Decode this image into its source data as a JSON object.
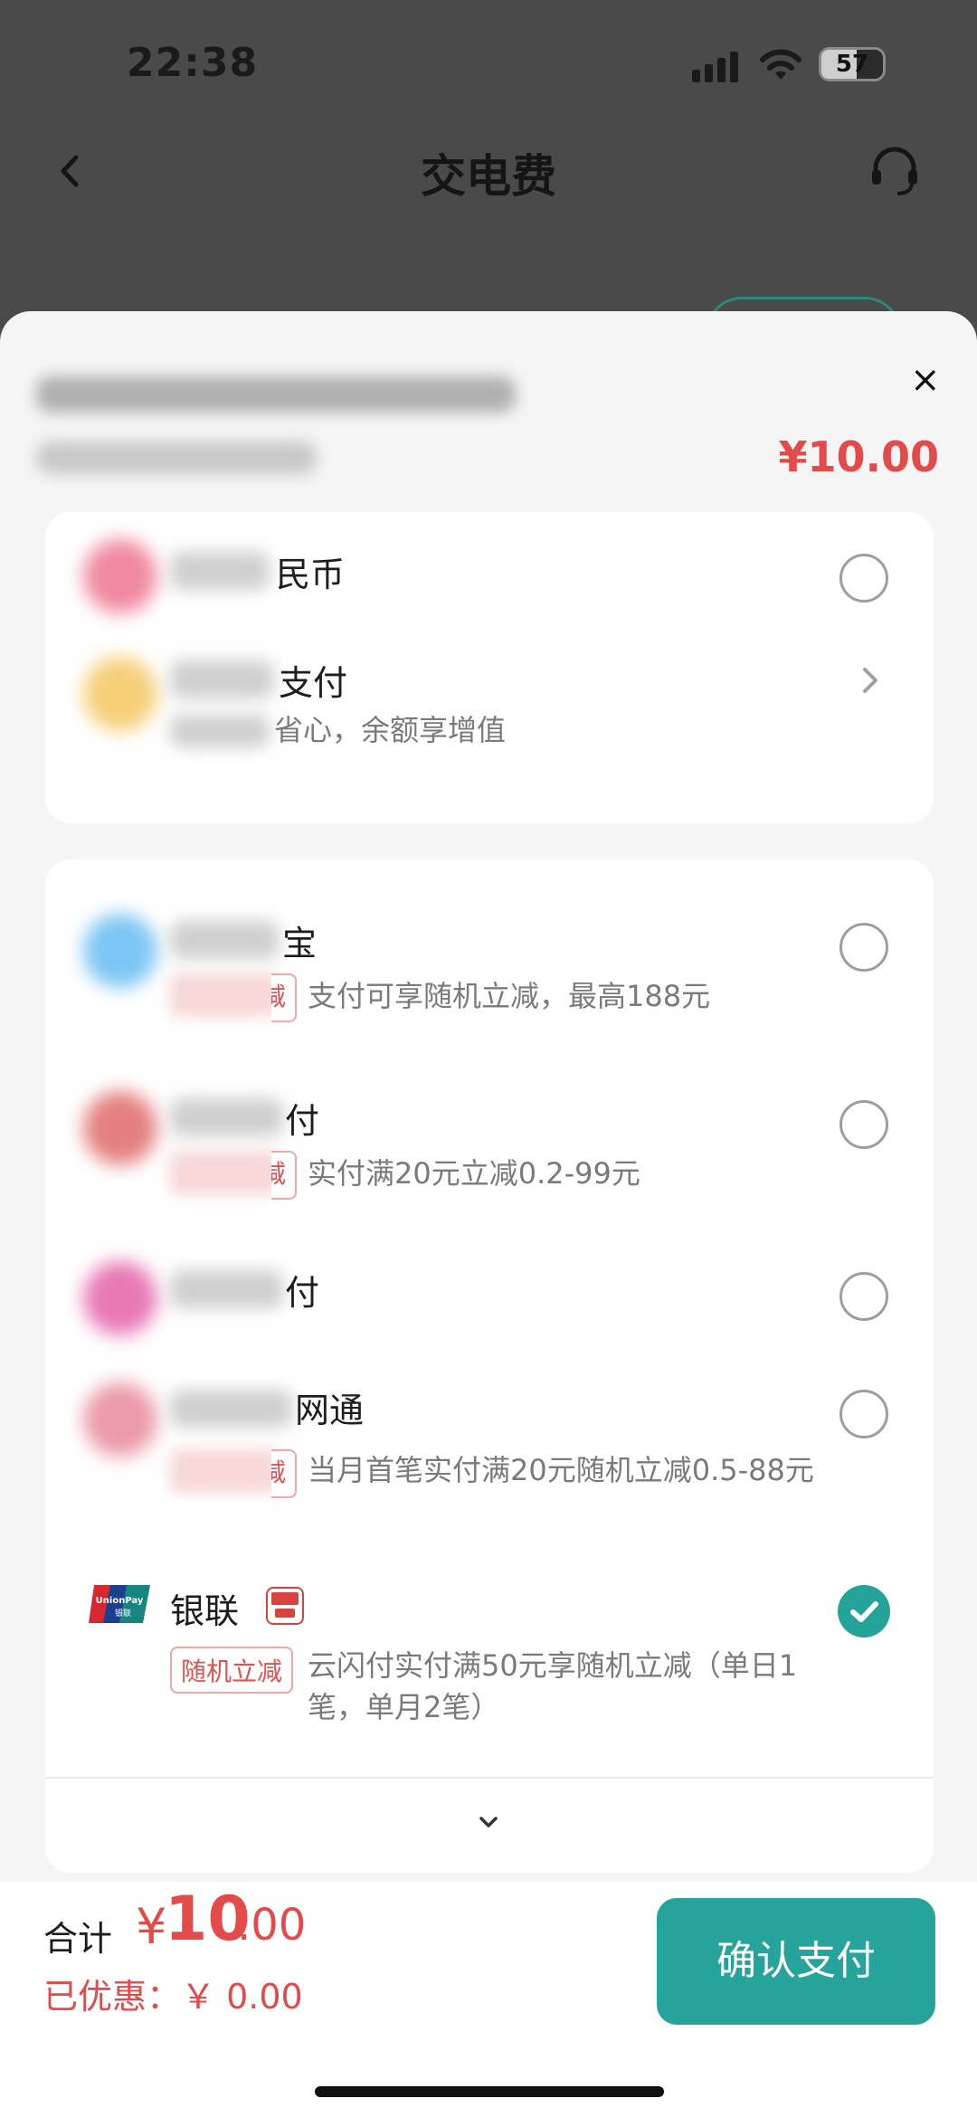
{
  "status_bar": {
    "time": "22:38",
    "battery": "57"
  },
  "header": {
    "title": "交电费"
  },
  "sheet": {
    "close_symbol": "×",
    "amount": "¥10.00"
  },
  "methods_top": [
    {
      "label": "民币",
      "sub": ""
    },
    {
      "label": "支付",
      "sub": "省心，余额享增值"
    }
  ],
  "methods_main": [
    {
      "label": "宝",
      "tag_tail": "减",
      "sub": "支付可享随机立减，最高188元"
    },
    {
      "label": "付",
      "tag_tail": "减",
      "sub": "实付满20元立减0.2-99元"
    },
    {
      "label": "付",
      "tag_tail": "",
      "sub": ""
    },
    {
      "label": "网通",
      "tag_tail": "减",
      "sub": "当月首笔实付满20元随机立减0.5-88元"
    },
    {
      "label": "银联",
      "tag": "随机立减",
      "sub": "云闪付实付满50元享随机立减（单日1笔，单月2笔）",
      "selected": true,
      "logo_text": "UnionPay 银联",
      "yun_text": "云闪付"
    }
  ],
  "footer": {
    "total_label": "合计",
    "currency": "¥",
    "total_int": "10",
    "total_dec": ".00",
    "discount": "已优惠：￥ 0.00",
    "pay_button": "确认支付"
  },
  "colors": {
    "accent": "#26a39b",
    "price": "#e34a4a",
    "overlay": "#4a4a4a"
  }
}
